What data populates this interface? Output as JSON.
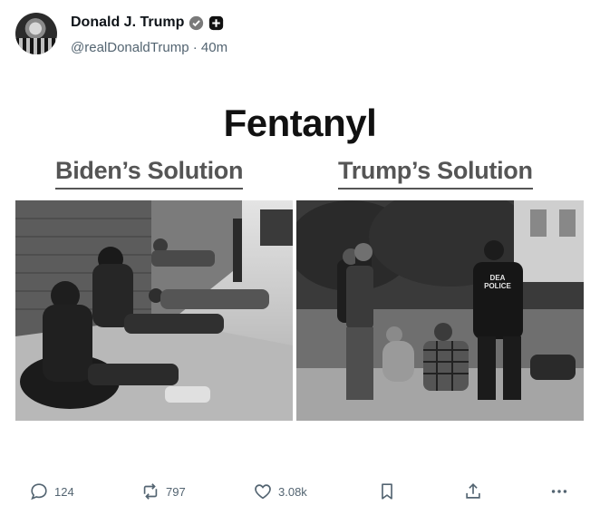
{
  "author": {
    "name": "Donald J. Trump",
    "handle": "@realDonaldTrump",
    "separator": "·",
    "time": "40m"
  },
  "image": {
    "headline": "Fentanyl",
    "left_caption": "Biden’s Solution",
    "right_caption": "Trump’s Solution",
    "vest_text_1": "DEA",
    "vest_text_2": "POLICE"
  },
  "actions": {
    "replies": "124",
    "reposts": "797",
    "likes": "3.08k"
  },
  "icons": [
    "verified-badge-icon",
    "subscribe-plus-icon",
    "reply-icon",
    "repost-icon",
    "like-icon",
    "bookmark-icon",
    "share-icon",
    "more-icon"
  ]
}
